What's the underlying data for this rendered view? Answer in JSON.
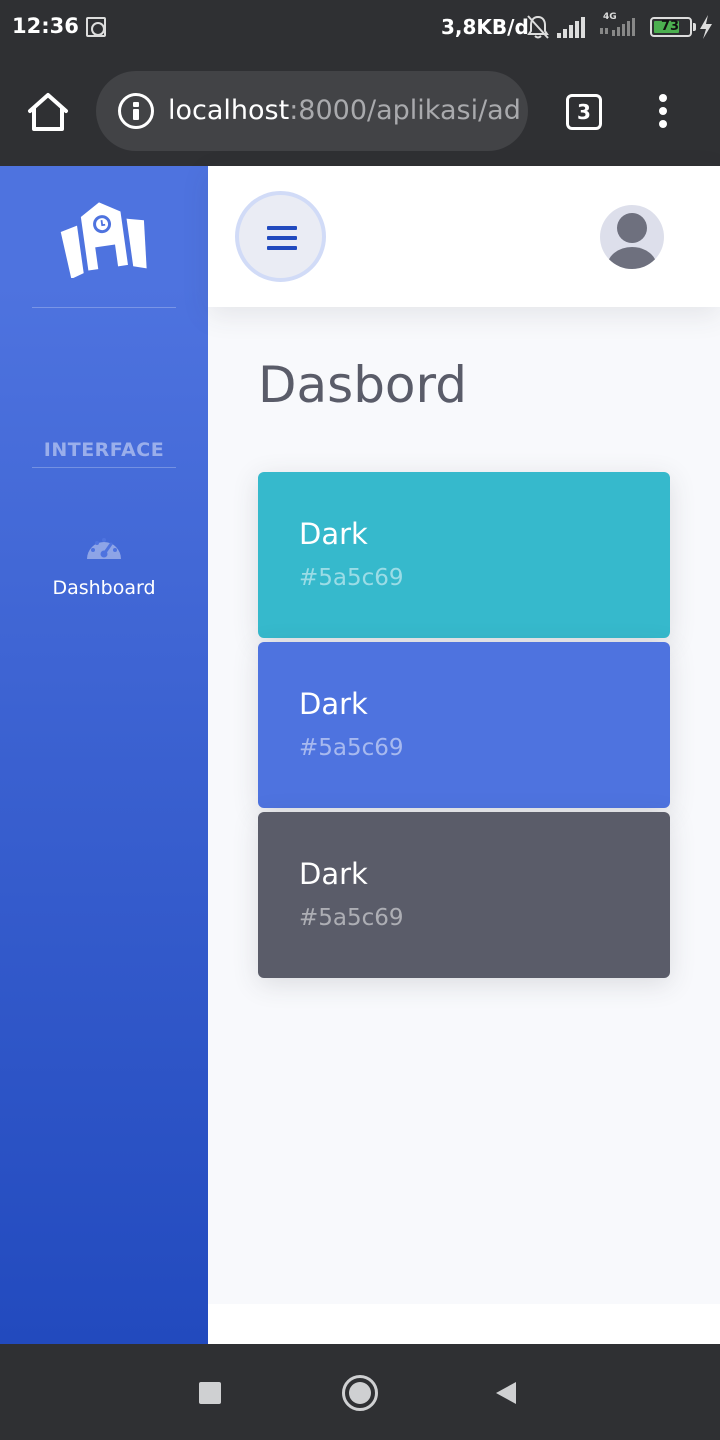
{
  "status_bar": {
    "time": "12:36",
    "net_speed": "3,8KB/d",
    "network_type": "4G",
    "battery_level": "73",
    "icons": [
      "notification-icon",
      "bell-off-icon",
      "signal-icon",
      "signal-4g-icon",
      "battery-icon",
      "charging-bolt-icon"
    ]
  },
  "browser": {
    "url_host": "localhost",
    "url_path": ":8000/aplikasi/ad",
    "tab_count": "3",
    "icons": [
      "home-icon",
      "info-icon",
      "tabs-icon",
      "more-vert-icon"
    ]
  },
  "sidebar": {
    "brand_icon": "school-icon",
    "heading": "INTERFACE",
    "items": [
      {
        "label": "Dashboard",
        "icon": "tachometer-icon"
      }
    ]
  },
  "topbar": {
    "toggle_icon": "hamburger-icon",
    "avatar_icon": "user-avatar-icon"
  },
  "page": {
    "title": "Dasbord",
    "cards": [
      {
        "name": "Dark",
        "hex": "#5a5c69",
        "bg_color": "#36b9cc"
      },
      {
        "name": "Dark",
        "hex": "#5a5c69",
        "bg_color": "#4e73df"
      },
      {
        "name": "Dark",
        "hex": "#5a5c69",
        "bg_color": "#5a5c69"
      }
    ]
  },
  "colors": {
    "primary": "#4e73df",
    "primary_dark": "#224abe",
    "info": "#36b9cc",
    "dark": "#5a5c69",
    "page_bg": "#f8f9fc"
  },
  "android_nav": {
    "icons": [
      "recent-apps-icon",
      "home-button-icon",
      "back-icon"
    ]
  }
}
